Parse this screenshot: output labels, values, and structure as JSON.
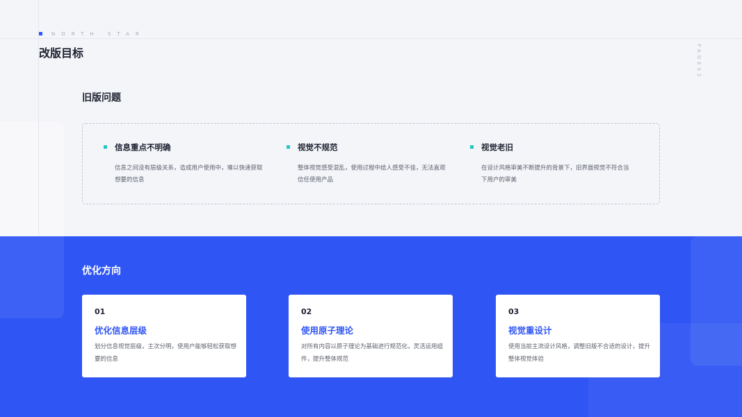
{
  "header": {
    "brand": "NORTH STAR",
    "title": "改版目标",
    "page_tag": "PAGE02"
  },
  "old_version": {
    "title": "旧版问题",
    "bullet_color": "#22c6c2",
    "items": [
      {
        "title": "信息重点不明确",
        "desc": "信息之间没有层级关系，造成用户使用中，难以快速获取想要的信息"
      },
      {
        "title": "视觉不规范",
        "desc": "整体视觉感受混乱，使用过程中给人感受不佳，无法直观信任使用产品"
      },
      {
        "title": "视觉老旧",
        "desc": "在设计风格审美不断提升的背景下，旧界面视觉不符合当下用户的审美"
      }
    ]
  },
  "optimization": {
    "title": "优化方向",
    "accent_color": "#2f55f4",
    "cards": [
      {
        "num": "01",
        "title": "优化信息层级",
        "desc": "划分信息视觉层级，主次分明，使用户能够轻松获取想要的信息"
      },
      {
        "num": "02",
        "title": "使用原子理论",
        "desc": "对所有内容以原子理论为基础进行规范化，灵活运用组件，提升整体规范"
      },
      {
        "num": "03",
        "title": "视觉重设计",
        "desc": "使用当前主流设计风格，调整旧版不合适的设计，提升整体视觉体验"
      }
    ]
  }
}
